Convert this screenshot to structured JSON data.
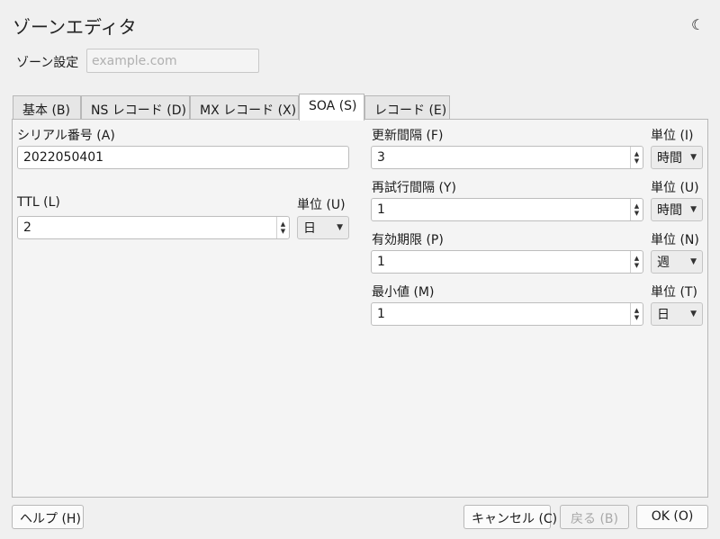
{
  "window": {
    "title": "ゾーンエディタ",
    "theme_icon": "☾"
  },
  "zone": {
    "label": "ゾーン設定",
    "placeholder": "example.com"
  },
  "tabs": [
    {
      "label": "基本 (B)"
    },
    {
      "label": "NS レコード (D)"
    },
    {
      "label": "MX レコード (X)"
    },
    {
      "label": "SOA (S)"
    },
    {
      "label": "レコード (E)"
    }
  ],
  "soa": {
    "serial": {
      "label": "シリアル番号 (A)",
      "value": "2022050401"
    },
    "ttl": {
      "label": "TTL (L)",
      "value": "2",
      "unit_label": "単位 (U)",
      "unit": "日"
    },
    "refresh": {
      "label": "更新間隔 (F)",
      "value": "3",
      "unit_label": "単位 (I)",
      "unit": "時間"
    },
    "retry": {
      "label": "再試行間隔 (Y)",
      "value": "1",
      "unit_label": "単位 (U)",
      "unit": "時間"
    },
    "expire": {
      "label": "有効期限 (P)",
      "value": "1",
      "unit_label": "単位 (N)",
      "unit": "週"
    },
    "minimum": {
      "label": "最小値 (M)",
      "value": "1",
      "unit_label": "単位 (T)",
      "unit": "日"
    }
  },
  "buttons": {
    "help": "ヘルプ (H)",
    "cancel": "キャンセル (C)",
    "back": "戻る (B)",
    "ok": "OK (O)"
  }
}
